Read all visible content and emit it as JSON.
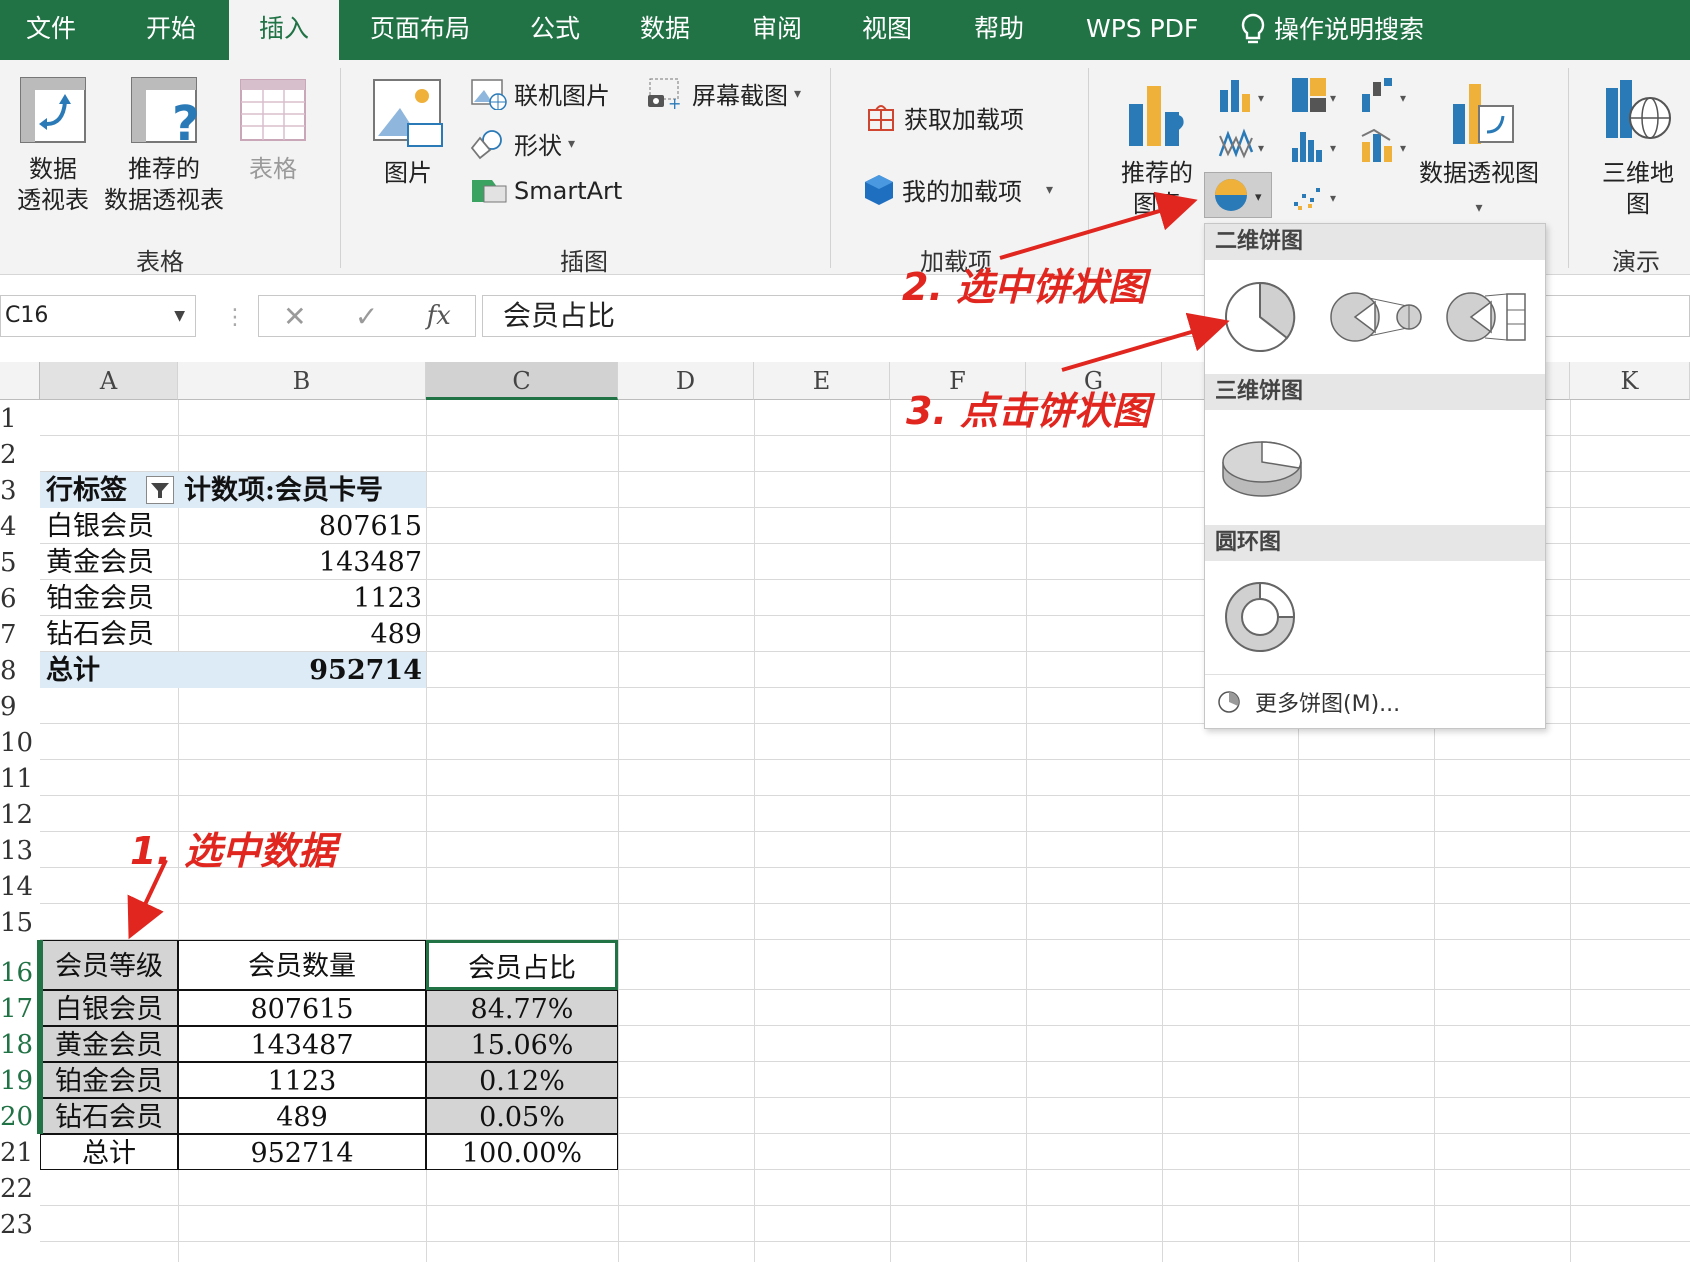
{
  "ribbon_tabs": [
    "文件",
    "开始",
    "插入",
    "页面布局",
    "公式",
    "数据",
    "审阅",
    "视图",
    "帮助",
    "WPS PDF",
    "操作说明搜索"
  ],
  "active_tab": "插入",
  "ribbon": {
    "tables": {
      "pivot_table": "数据\n透视表",
      "recommended_pivot": "推荐的\n数据透视表",
      "table": "表格",
      "group_label": "表格"
    },
    "illustrations": {
      "pictures": "图片",
      "online_pictures": "联机图片",
      "shapes": "形状",
      "smartart": "SmartArt",
      "screenshot": "屏幕截图",
      "group_label": "插图"
    },
    "addins": {
      "get_addins": "获取加载项",
      "my_addins": "我的加载项",
      "group_label": "加载项"
    },
    "charts": {
      "recommended_charts": "推荐的\n图表",
      "pivot_chart": "数据透视图"
    },
    "tours": {
      "map_3d": "三维地\n图",
      "group_label": "演示"
    }
  },
  "formula_bar": {
    "name_box": "C16",
    "cancel": "✕",
    "enter": "✓",
    "fx": "fx",
    "content": "会员占比"
  },
  "columns": [
    "A",
    "B",
    "C",
    "D",
    "E",
    "F",
    "G",
    "K"
  ],
  "rows": [
    "1",
    "2",
    "3",
    "4",
    "5",
    "6",
    "7",
    "8",
    "9",
    "10",
    "11",
    "12",
    "13",
    "14",
    "15",
    "16",
    "17",
    "18",
    "19",
    "20",
    "21",
    "22",
    "23"
  ],
  "pivot": {
    "header_row_label": "行标签",
    "header_value": "计数项:会员卡号",
    "rows": [
      {
        "label": "白银会员",
        "value": "807615"
      },
      {
        "label": "黄金会员",
        "value": "143487"
      },
      {
        "label": "铂金会员",
        "value": "1123"
      },
      {
        "label": "钻石会员",
        "value": "489"
      }
    ],
    "total_label": "总计",
    "total_value": "952714"
  },
  "table": {
    "headers": [
      "会员等级",
      "会员数量",
      "会员占比"
    ],
    "rows": [
      [
        "白银会员",
        "807615",
        "84.77%"
      ],
      [
        "黄金会员",
        "143487",
        "15.06%"
      ],
      [
        "铂金会员",
        "1123",
        "0.12%"
      ],
      [
        "钻石会员",
        "489",
        "0.05%"
      ],
      [
        "总计",
        "952714",
        "100.00%"
      ]
    ]
  },
  "dropdown": {
    "sections": [
      "二维饼图",
      "三维饼图",
      "圆环图"
    ],
    "more": "更多饼图(M)..."
  },
  "annotations": {
    "step1": "1. 选中数据",
    "step2": "2. 选中饼状图",
    "step3": "3. 点击饼状图"
  },
  "colors": {
    "excel_green": "#217346",
    "pivot_header_fill": "#ddebf7",
    "selection_fill": "#d4d4d4",
    "annotation_red": "#e0261f"
  }
}
